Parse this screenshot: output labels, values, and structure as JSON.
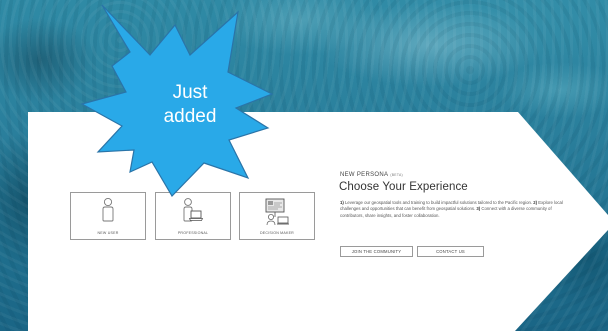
{
  "callout": {
    "line1": "Just",
    "line2": "added",
    "fill": "#29a9e8",
    "stroke": "#2a74a8"
  },
  "personas": [
    {
      "label": "NEW USER",
      "icon": "person-icon"
    },
    {
      "label": "PROFESSIONAL",
      "icon": "person-laptop-icon"
    },
    {
      "label": "DECISION MAKER",
      "icon": "presentation-board-icon"
    }
  ],
  "header": {
    "badge": "NEW PERSONA",
    "beta": "(BETA)",
    "title": "Choose Your Experience"
  },
  "description": {
    "n1": "1)",
    "t1": " Leverage our geospatial tools and training to build impactful solutions tailored to the Pacific region. ",
    "n2": "2)",
    "t2": " Explore local challenges and opportunities that can benefit from geospatial solutions. ",
    "n3": "3)",
    "t3": " Connect with a diverse community of contributors, share insights, and foster collaboration."
  },
  "actions": {
    "join": "JOIN THE COMMUNITY",
    "contact": "CONTACT US"
  }
}
